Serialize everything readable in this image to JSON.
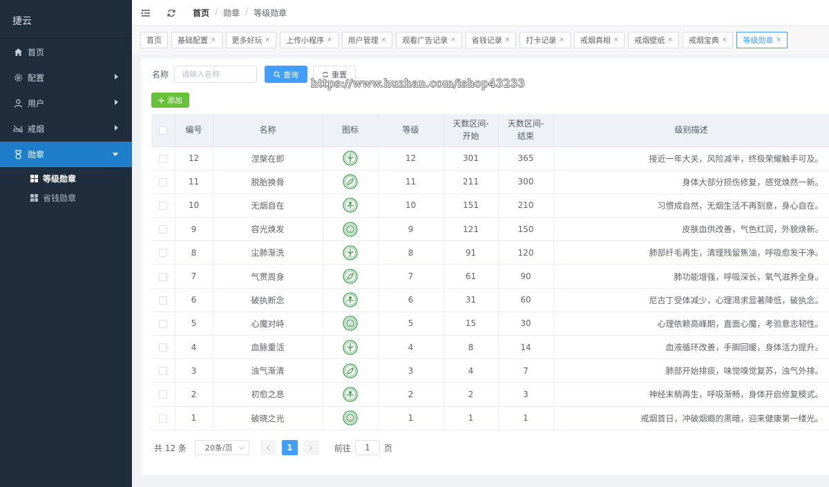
{
  "brand": "捷云",
  "sidebar": {
    "items": [
      {
        "label": "首页",
        "icon": "home-icon"
      },
      {
        "label": "配置",
        "icon": "gear-icon"
      },
      {
        "label": "用户",
        "icon": "user-icon"
      },
      {
        "label": "戒烟",
        "icon": "no-smoking-icon"
      },
      {
        "label": "勋章",
        "icon": "medal-icon"
      }
    ],
    "sub_items": [
      {
        "label": "等级勋章"
      },
      {
        "label": "省钱勋章"
      }
    ]
  },
  "header": {
    "breadcrumb": [
      "首页",
      "勋章",
      "等级勋章"
    ],
    "separator": "/"
  },
  "tags": [
    {
      "label": "首页",
      "closable": false
    },
    {
      "label": "基础配置",
      "closable": true
    },
    {
      "label": "更多好玩",
      "closable": true
    },
    {
      "label": "上传小程序",
      "closable": true
    },
    {
      "label": "用户管理",
      "closable": true
    },
    {
      "label": "观看广告记录",
      "closable": true
    },
    {
      "label": "省钱记录",
      "closable": true
    },
    {
      "label": "打卡记录",
      "closable": true
    },
    {
      "label": "戒烟真相",
      "closable": true
    },
    {
      "label": "戒烟壁纸",
      "closable": true
    },
    {
      "label": "戒烟宝典",
      "closable": true
    },
    {
      "label": "等级勋章",
      "closable": true,
      "active": true
    }
  ],
  "tag_close": "×",
  "search": {
    "label": "名称",
    "placeholder": "请输入名称",
    "query_button": "查询",
    "reset_button": "重置"
  },
  "add_button": "添加",
  "watermark": "https://www.huzhan.com/ishop43233",
  "table": {
    "columns": [
      "编号",
      "名称",
      "图标",
      "等级",
      "天数区间-开始",
      "天数区间-结束",
      "级别描述"
    ],
    "rows": [
      {
        "id": "12",
        "name": "涅槃在即",
        "level": "12",
        "start": "301",
        "end": "365",
        "desc": "接近一年大关，风险减半，终极荣耀触手可及。"
      },
      {
        "id": "11",
        "name": "脱胎换骨",
        "level": "11",
        "start": "211",
        "end": "300",
        "desc": "身体大部分损伤修复，感觉焕然一新。"
      },
      {
        "id": "10",
        "name": "无烟自在",
        "level": "10",
        "start": "151",
        "end": "210",
        "desc": "习惯成自然，无烟生活不再刻意，身心自在。"
      },
      {
        "id": "9",
        "name": "容光焕发",
        "level": "9",
        "start": "121",
        "end": "150",
        "desc": "皮肤血供改善，气色红润，外貌焕新。"
      },
      {
        "id": "8",
        "name": "尘肺渐洗",
        "level": "8",
        "start": "91",
        "end": "120",
        "desc": "肺部纤毛再生，清理残留焦油，呼吸愈发干净。"
      },
      {
        "id": "7",
        "name": "气贯周身",
        "level": "7",
        "start": "61",
        "end": "90",
        "desc": "肺功能增强，呼吸深长，氧气滋养全身。"
      },
      {
        "id": "6",
        "name": "破执断念",
        "level": "6",
        "start": "31",
        "end": "60",
        "desc": "尼古丁受体减少，心理渴求显著降低，破执念。"
      },
      {
        "id": "5",
        "name": "心魔对峙",
        "level": "5",
        "start": "15",
        "end": "30",
        "desc": "心理依赖高峰期，直面心魔，考验意志韧性。"
      },
      {
        "id": "4",
        "name": "血脉重活",
        "level": "4",
        "start": "8",
        "end": "14",
        "desc": "血液循环改善，手脚回暖，身体活力提升。"
      },
      {
        "id": "3",
        "name": "浊气渐清",
        "level": "3",
        "start": "4",
        "end": "7",
        "desc": "肺部开始排痰，味觉嗅觉复苏，浊气外排。"
      },
      {
        "id": "2",
        "name": "初愈之息",
        "level": "2",
        "start": "2",
        "end": "3",
        "desc": "神经末梢再生，呼吸渐畅，身体开启修复模式。"
      },
      {
        "id": "1",
        "name": "破晓之光",
        "level": "1",
        "start": "1",
        "end": "1",
        "desc": "戒烟首日，冲破烟瘾的黑暗，迎来健康第一缕光。"
      }
    ]
  },
  "pagination": {
    "total": "共 12 条",
    "page_size": "20条/页",
    "current_page": "1",
    "goto_prefix": "前往",
    "goto_value": "1",
    "goto_suffix": "页"
  },
  "colors": {
    "sidebar_bg": "#1f2d3d",
    "active_menu": "#1e7ec9",
    "primary": "#409eff",
    "success": "#67c23a",
    "medal_green": "#3ca24a"
  }
}
